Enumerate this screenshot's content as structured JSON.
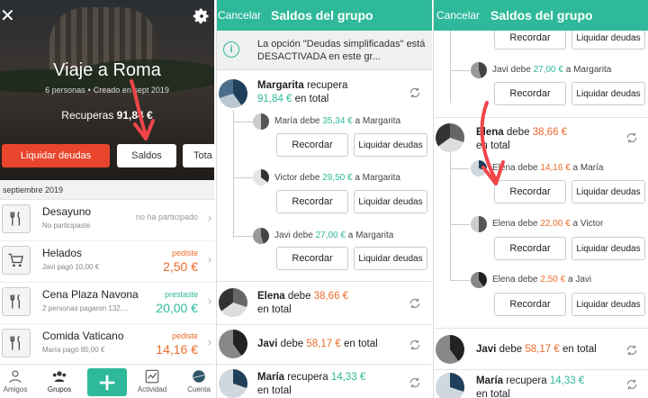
{
  "panel1": {
    "group_title": "Viaje a Roma",
    "members": "6 personas",
    "created": "Creado en sept 2019",
    "recuperas_label": "Recuperas",
    "recuperas_amount": "91,84 €",
    "btn_liquidar": "Liquidar deudas",
    "btn_saldos": "Saldos",
    "btn_totales": "Tota",
    "section": "septiembre 2019",
    "expenses": [
      {
        "name": "Desayuno",
        "meta": "No participaste",
        "right_label": "no ha participado",
        "amount": "",
        "icon": "cutlery-icon"
      },
      {
        "name": "Helados",
        "meta": "Javi pagó 10,00 €",
        "right_label": "pediste",
        "amount": "2,50 €",
        "icon": "cart-icon"
      },
      {
        "name": "Cena Plaza Navona",
        "meta": "2 personas pagaron 132,...",
        "right_label": "prestaste",
        "amount": "20,00 €",
        "icon": "cutlery-icon"
      },
      {
        "name": "Comida Vaticano",
        "meta": "María pagó 85,00 €",
        "right_label": "pediste",
        "amount": "14,16 €",
        "icon": "cutlery-icon"
      }
    ],
    "tabs": [
      "Amigos",
      "Grupos",
      "Actividad",
      "Cuenta"
    ]
  },
  "panel2": {
    "cancel": "Cancelar",
    "title": "Saldos del grupo",
    "info": "La opción \"Deudas simplificadas\" está DESACTIVADA en este gr...",
    "margarita_name": "Margarita",
    "margarita_verb": "recupera",
    "margarita_amount": "91,84 €",
    "in_total": "en total",
    "debts": [
      {
        "who": "María debe",
        "amount": "35,34 €",
        "to": "a Margarita"
      },
      {
        "who": "Victor debe",
        "amount": "29,50 €",
        "to": "a Margarita"
      },
      {
        "who": "Javi debe",
        "amount": "27,00 €",
        "to": "a Margarita"
      }
    ],
    "remind": "Recordar",
    "settle": "Liquidar deudas",
    "elena_name": "Elena",
    "elena_verb": "debe",
    "elena_amount": "38,66 €",
    "javi_name": "Javi",
    "javi_verb": "debe",
    "javi_amount": "58,17 €",
    "maria_name": "María",
    "maria_verb": "recupera",
    "maria_amount": "14,33 €"
  },
  "panel3": {
    "cancel": "Cancelar",
    "title": "Saldos del grupo",
    "top_debt": {
      "who": "Javi debe",
      "amount": "27,00 €",
      "to": "a Margarita"
    },
    "remind": "Recordar",
    "settle": "Liquidar deudas",
    "elena_name": "Elena",
    "elena_verb": "debe",
    "elena_amount": "38,66 €",
    "in_total": "en total",
    "elena_debts": [
      {
        "who": "Elena debe",
        "amount": "14,16 €",
        "to": "a María"
      },
      {
        "who": "Elena debe",
        "amount": "22,00 €",
        "to": "a Victor"
      },
      {
        "who": "Elena debe",
        "amount": "2,50 €",
        "to": "a Javi"
      }
    ],
    "javi_name": "Javi",
    "javi_verb": "debe",
    "javi_amount": "58,17 €",
    "maria_name": "María",
    "maria_verb": "recupera",
    "maria_amount": "14,33 €"
  },
  "colors": {
    "accent": "#2eb99a",
    "orange": "#ea6b2b",
    "red_button": "#e8452c",
    "annotation_arrow": "#f0454a"
  }
}
